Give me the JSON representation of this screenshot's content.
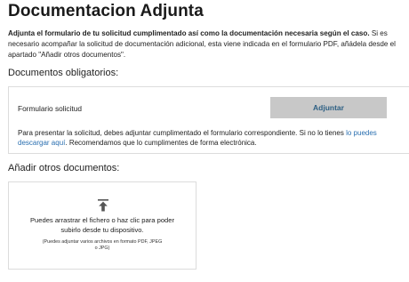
{
  "page": {
    "title": "Documentacion Adjunta",
    "intro_bold": "Adjunta el formulario de tu solicitud cumplimentado así como la documentación necesaria según el caso.",
    "intro_rest": " Si es necesario acompañar la solicitud de documentación adicional, esta viene indicada en el formulario PDF, añádela desde el apartado \"Añadir otros documentos\"."
  },
  "required": {
    "heading": "Documentos obligatorios:",
    "item_label": "Formulario solicitud",
    "attach_label": "Adjuntar",
    "help_before": "Para presentar la solicitud, debes adjuntar cumplimentado el formulario correspondiente. Si no lo tienes ",
    "help_link": "lo puedes descargar aquí",
    "help_after": ". Recomendamos que lo cumplimentes de forma electrónica."
  },
  "other": {
    "heading": "Añadir otros documentos:",
    "drop_text_line1": "Puedes arrastrar el fichero o haz clic para poder",
    "drop_text_line2": "subirlo desde tu dispositivo.",
    "drop_note_line1": "(Puedes adjuntar varios archivos en formato PDF, JPEG",
    "drop_note_line2": "o JPG)",
    "icon": "upload-icon"
  },
  "colors": {
    "button_bg": "#c8c8c8",
    "button_text": "#2d5f83",
    "link": "#2a6fb0",
    "border": "#dcdcdc"
  }
}
